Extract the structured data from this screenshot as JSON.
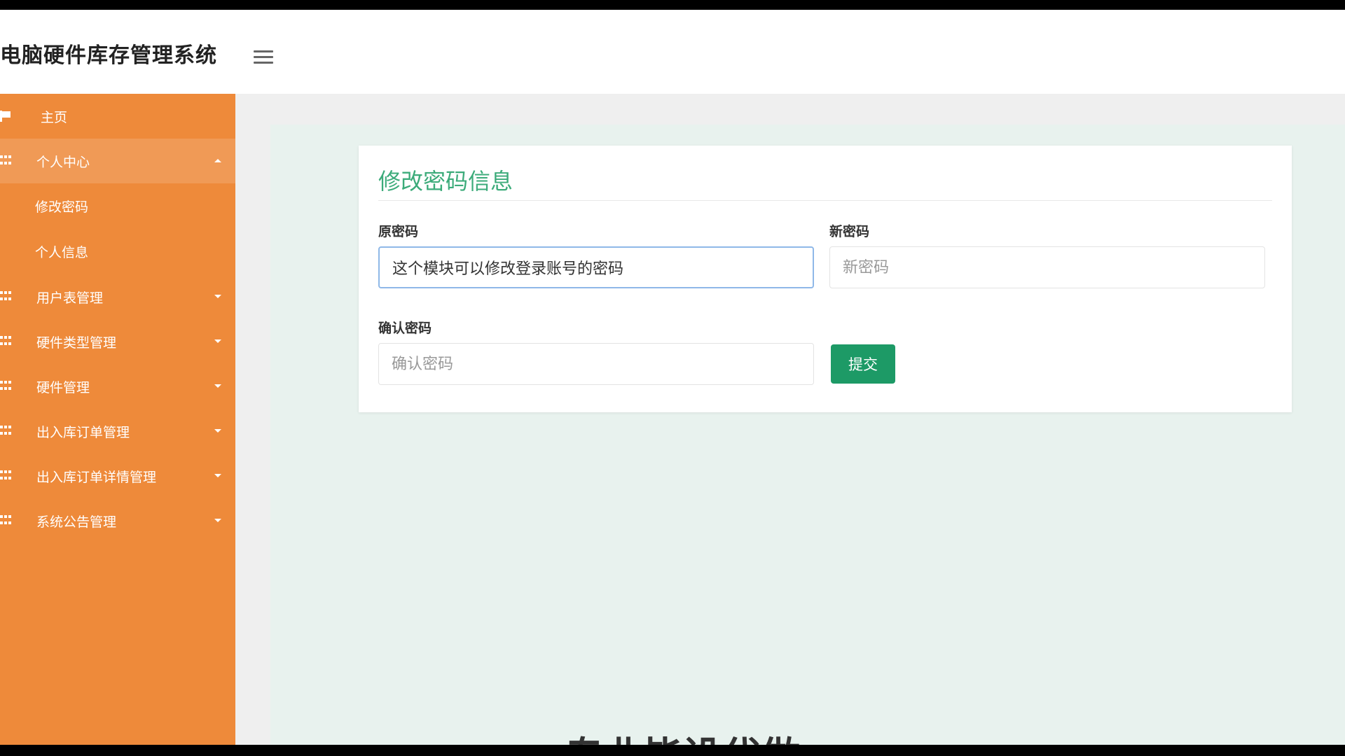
{
  "header": {
    "app_title": "电脑硬件库存管理系统"
  },
  "sidebar": {
    "items": [
      {
        "label": "主页",
        "icon": "flag-icon"
      },
      {
        "label": "个人中心",
        "icon": "grid-icon",
        "expanded": true
      },
      {
        "label": "修改密码"
      },
      {
        "label": "个人信息"
      },
      {
        "label": "用户表管理",
        "icon": "grid-icon"
      },
      {
        "label": "硬件类型管理",
        "icon": "grid-icon"
      },
      {
        "label": "硬件管理",
        "icon": "grid-icon"
      },
      {
        "label": "出入库订单管理",
        "icon": "grid-icon"
      },
      {
        "label": "出入库订单详情管理",
        "icon": "grid-icon"
      },
      {
        "label": "系统公告管理",
        "icon": "grid-icon"
      }
    ]
  },
  "form": {
    "title": "修改密码信息",
    "old_password_label": "原密码",
    "old_password_value": "这个模块可以修改登录账号的密码",
    "new_password_label": "新密码",
    "new_password_placeholder": "新密码",
    "confirm_password_label": "确认密码",
    "confirm_password_placeholder": "确认密码",
    "submit_label": "提交"
  },
  "overlay": {
    "caption_partial": "专业毕设代做"
  },
  "colors": {
    "sidebar": "#ee8a3a",
    "sidebar_active": "#f09a56",
    "title_green": "#3cab7a",
    "button_green": "#1d9a66",
    "content_bg": "#e8f2ee"
  }
}
